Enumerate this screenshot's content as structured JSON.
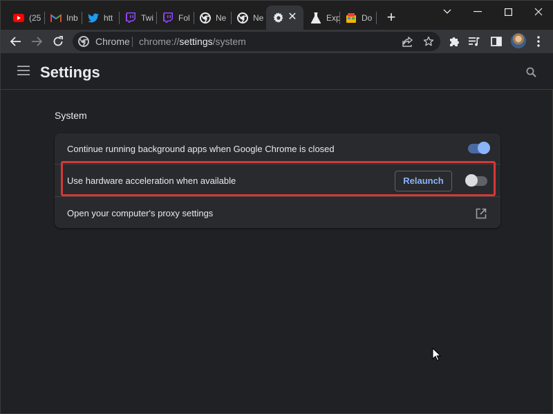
{
  "tabs": [
    {
      "title": "(25",
      "icon": "youtube-icon",
      "color": "#ff0000"
    },
    {
      "title": "Inb",
      "icon": "gmail-icon",
      "color": "#ea4335"
    },
    {
      "title": "htt",
      "icon": "twitter-icon",
      "color": "#1d9bf0"
    },
    {
      "title": "Twi",
      "icon": "twitch-icon",
      "color": "#9146ff"
    },
    {
      "title": "Fol",
      "icon": "twitch-icon",
      "color": "#9146ff"
    },
    {
      "title": "Ne",
      "icon": "chrome-icon",
      "color": "#e8eaed"
    },
    {
      "title": "Ne",
      "icon": "chrome-icon",
      "color": "#e8eaed"
    },
    {
      "title": "",
      "icon": "gear-icon",
      "color": "#e8eaed",
      "active": true
    },
    {
      "title": "Exp",
      "icon": "flask-icon",
      "color": "#e8eaed"
    },
    {
      "title": "Do",
      "icon": "doodle-icon",
      "color": "#f5b400"
    }
  ],
  "omnibox": {
    "chip_label": "Chrome",
    "url_scheme": "chrome://",
    "url_host": "settings",
    "url_path": "/system"
  },
  "settings": {
    "title": "Settings",
    "section_title": "System",
    "rows": [
      {
        "label": "Continue running background apps when Google Chrome is closed",
        "toggle": "on"
      },
      {
        "label": "Use hardware acceleration when available",
        "button": "Relaunch",
        "toggle": "off"
      },
      {
        "label": "Open your computer's proxy settings",
        "icon": "external-link-icon"
      }
    ]
  },
  "colors": {
    "accent": "#8ab4f8",
    "highlight_border": "#d63838",
    "background": "#202124",
    "card": "#292a2d"
  }
}
